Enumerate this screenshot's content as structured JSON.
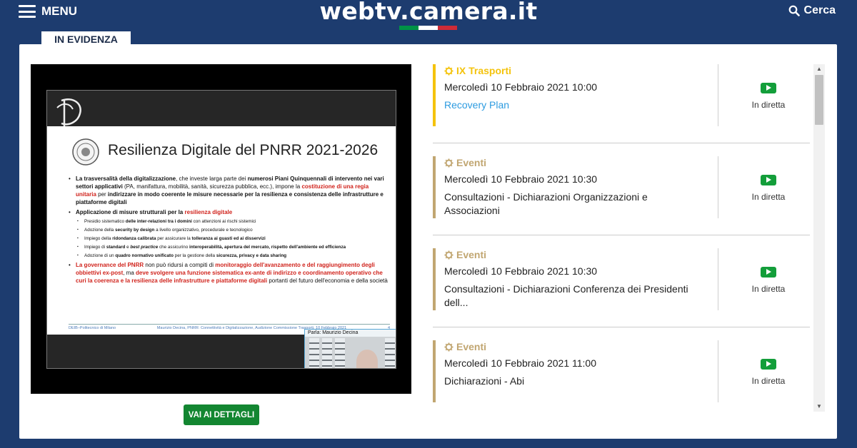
{
  "header": {
    "menu_label": "MENU",
    "logo": "webtv.camera.it",
    "search_label": "Cerca",
    "flag_colors": [
      "#009246",
      "#ffffff",
      "#ce2b37"
    ]
  },
  "tab": {
    "label": "IN EVIDENZA"
  },
  "player": {
    "slide_title": "Resilienza Digitale del PNRR 2021-2026",
    "footer_left": "DEIB–Politecnico di Milano",
    "footer_mid": "Maurizio Decina, PNRR: Connettività e Digitalizzazione, Audizione Commissione Trasporti, 10 Febbraio 2021",
    "footer_page": "4",
    "speaker_label": "Parla: Maurizio Decina"
  },
  "details_button": "VAI AI DETTAGLI",
  "colors": {
    "accent_active": "#f4c30c",
    "accent": "#c1a671",
    "link": "#2c9be0",
    "live": "#139e3a",
    "background": "#1d3c6f"
  },
  "events": [
    {
      "category": "IX Trasporti",
      "date": "Mercoledì 10 Febbraio 2021   10:00",
      "title": "Recovery Plan",
      "status": "In diretta",
      "active": true
    },
    {
      "category": "Eventi",
      "date": "Mercoledì 10 Febbraio 2021   10:30",
      "title": "Consultazioni - Dichiarazioni Organizzazioni e Associazioni",
      "status": "In diretta",
      "active": false
    },
    {
      "category": "Eventi",
      "date": "Mercoledì 10 Febbraio 2021   10:30",
      "title": "Consultazioni - Dichiarazioni Conferenza dei Presidenti dell...",
      "status": "In diretta",
      "active": false
    },
    {
      "category": "Eventi",
      "date": "Mercoledì 10 Febbraio 2021   11:00",
      "title": "Dichiarazioni - Abi",
      "status": "In diretta",
      "active": false
    }
  ]
}
